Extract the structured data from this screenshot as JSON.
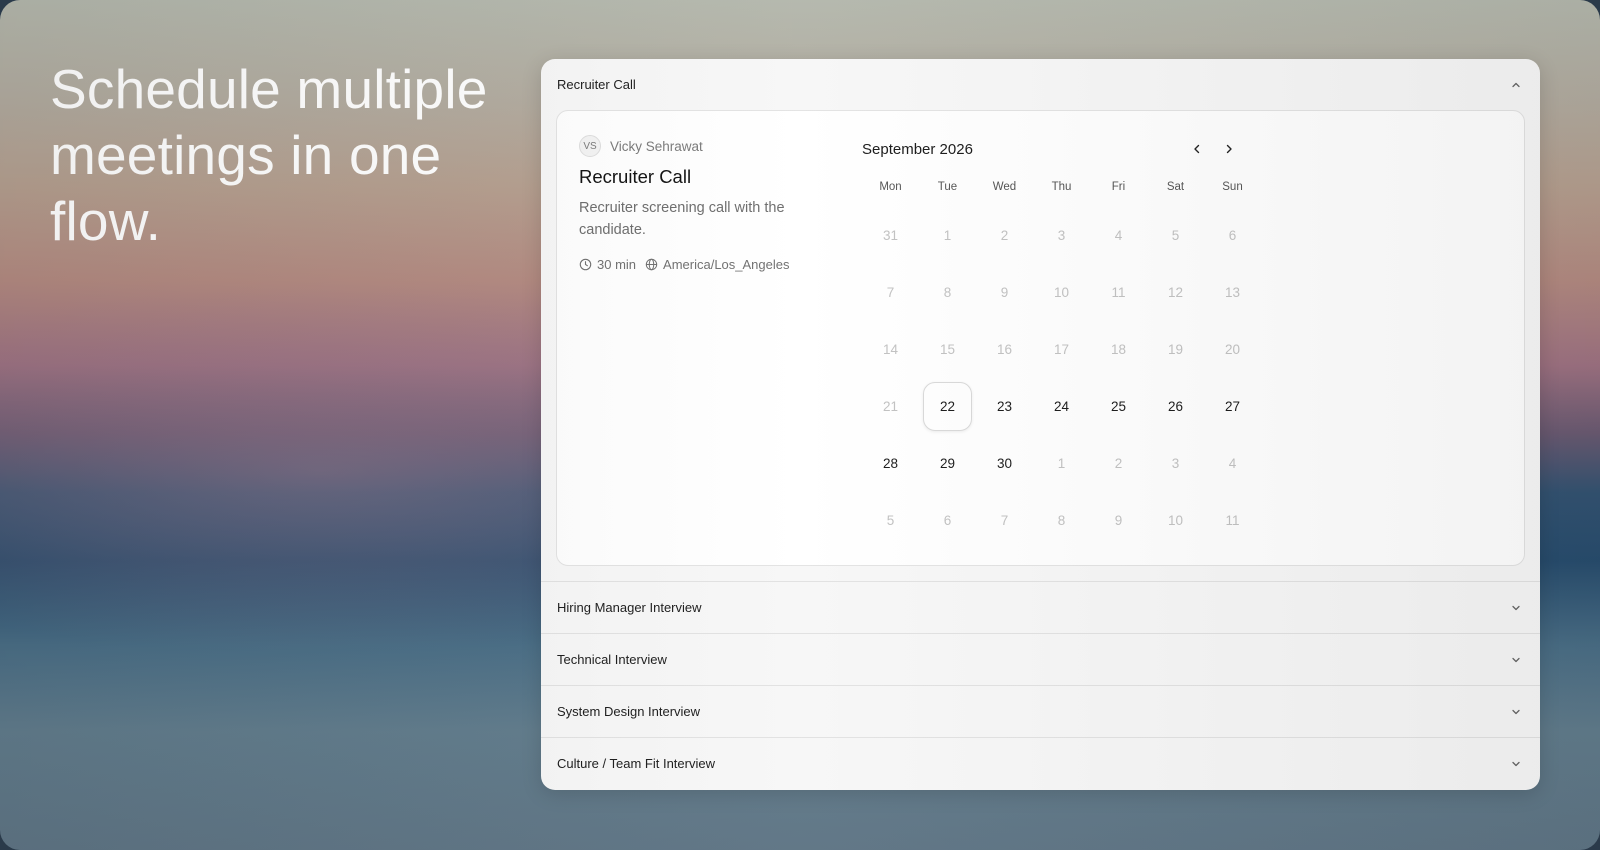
{
  "headline": "Schedule multiple meetings in one flow.",
  "sections": [
    {
      "label": "Recruiter Call",
      "state": "expanded"
    },
    {
      "label": "Hiring Manager Interview",
      "state": "collapsed"
    },
    {
      "label": "Technical Interview",
      "state": "collapsed"
    },
    {
      "label": "System Design Interview",
      "state": "collapsed"
    },
    {
      "label": "Culture / Team Fit Interview",
      "state": "collapsed"
    }
  ],
  "event": {
    "host_initials": "VS",
    "host_name": "Vicky Sehrawat",
    "title": "Recruiter Call",
    "description": "Recruiter screening call with the candidate.",
    "duration": "30 min",
    "timezone": "America/Los_Angeles"
  },
  "calendar": {
    "month_label": "September 2026",
    "weekdays": [
      "Mon",
      "Tue",
      "Wed",
      "Thu",
      "Fri",
      "Sat",
      "Sun"
    ],
    "weeks": [
      [
        {
          "d": "31",
          "available": false
        },
        {
          "d": "1",
          "available": false
        },
        {
          "d": "2",
          "available": false
        },
        {
          "d": "3",
          "available": false
        },
        {
          "d": "4",
          "available": false
        },
        {
          "d": "5",
          "available": false
        },
        {
          "d": "6",
          "available": false
        }
      ],
      [
        {
          "d": "7",
          "available": false
        },
        {
          "d": "8",
          "available": false
        },
        {
          "d": "9",
          "available": false
        },
        {
          "d": "10",
          "available": false
        },
        {
          "d": "11",
          "available": false
        },
        {
          "d": "12",
          "available": false
        },
        {
          "d": "13",
          "available": false
        }
      ],
      [
        {
          "d": "14",
          "available": false
        },
        {
          "d": "15",
          "available": false
        },
        {
          "d": "16",
          "available": false
        },
        {
          "d": "17",
          "available": false
        },
        {
          "d": "18",
          "available": false
        },
        {
          "d": "19",
          "available": false
        },
        {
          "d": "20",
          "available": false
        }
      ],
      [
        {
          "d": "21",
          "available": false
        },
        {
          "d": "22",
          "available": true,
          "selected": true
        },
        {
          "d": "23",
          "available": true
        },
        {
          "d": "24",
          "available": true
        },
        {
          "d": "25",
          "available": true
        },
        {
          "d": "26",
          "available": true
        },
        {
          "d": "27",
          "available": true
        }
      ],
      [
        {
          "d": "28",
          "available": true
        },
        {
          "d": "29",
          "available": true
        },
        {
          "d": "30",
          "available": true
        },
        {
          "d": "1",
          "available": false
        },
        {
          "d": "2",
          "available": false
        },
        {
          "d": "3",
          "available": false
        },
        {
          "d": "4",
          "available": false
        }
      ],
      [
        {
          "d": "5",
          "available": false
        },
        {
          "d": "6",
          "available": false
        },
        {
          "d": "7",
          "available": false
        },
        {
          "d": "8",
          "available": false
        },
        {
          "d": "9",
          "available": false
        },
        {
          "d": "10",
          "available": false
        },
        {
          "d": "11",
          "available": false
        }
      ]
    ]
  },
  "icons": {
    "collapse": "chevron-up-icon",
    "expand": "chevron-down-icon",
    "duration": "clock-icon",
    "timezone": "globe-icon",
    "prev": "chevron-left-icon",
    "next": "chevron-right-icon"
  }
}
